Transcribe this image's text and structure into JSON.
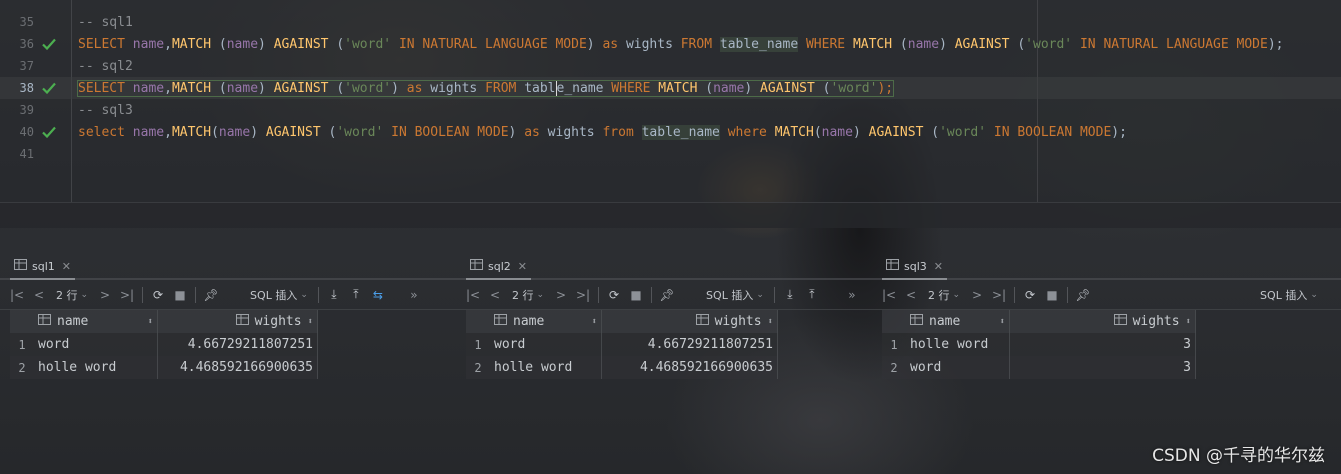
{
  "editor": {
    "lines": [
      {
        "num": "35",
        "checked": false,
        "current": false,
        "tokens": [
          {
            "t": "cm",
            "v": "-- sql1"
          }
        ]
      },
      {
        "num": "36",
        "checked": true,
        "current": false,
        "tokens": [
          {
            "t": "kw",
            "v": "SELECT "
          },
          {
            "t": "col",
            "v": "name"
          },
          {
            "t": "plain",
            "v": ","
          },
          {
            "t": "fn",
            "v": "MATCH "
          },
          {
            "t": "plain",
            "v": "("
          },
          {
            "t": "col",
            "v": "name"
          },
          {
            "t": "plain",
            "v": ") "
          },
          {
            "t": "fn",
            "v": "AGAINST "
          },
          {
            "t": "plain",
            "v": "("
          },
          {
            "t": "str",
            "v": "'word'"
          },
          {
            "t": "kw",
            "v": " IN NATURAL LANGUAGE MODE"
          },
          {
            "t": "plain",
            "v": ") "
          },
          {
            "t": "kw",
            "v": "as "
          },
          {
            "t": "plain",
            "v": "wights "
          },
          {
            "t": "kw",
            "v": "FROM "
          },
          {
            "t": "tbl",
            "v": "table_name"
          },
          {
            "t": "kw",
            "v": " WHERE "
          },
          {
            "t": "fn",
            "v": "MATCH "
          },
          {
            "t": "plain",
            "v": "("
          },
          {
            "t": "col",
            "v": "name"
          },
          {
            "t": "plain",
            "v": ") "
          },
          {
            "t": "fn",
            "v": "AGAINST "
          },
          {
            "t": "plain",
            "v": "("
          },
          {
            "t": "str",
            "v": "'word'"
          },
          {
            "t": "kw",
            "v": " IN NATURAL LANGUAGE MODE"
          },
          {
            "t": "plain",
            "v": ");"
          }
        ]
      },
      {
        "num": "37",
        "checked": false,
        "current": false,
        "tokens": [
          {
            "t": "cm",
            "v": "-- sql2"
          }
        ]
      },
      {
        "num": "38",
        "checked": true,
        "current": true,
        "tokens": [
          {
            "t": "kw",
            "v": "SELECT "
          },
          {
            "t": "col",
            "v": "name"
          },
          {
            "t": "plain",
            "v": ","
          },
          {
            "t": "fn",
            "v": "MATCH "
          },
          {
            "t": "plain",
            "v": "("
          },
          {
            "t": "col",
            "v": "name"
          },
          {
            "t": "plain",
            "v": ") "
          },
          {
            "t": "fn",
            "v": "AGAINST "
          },
          {
            "t": "plain",
            "v": "("
          },
          {
            "t": "str",
            "v": "'word'"
          },
          {
            "t": "plain",
            "v": ") "
          },
          {
            "t": "kw",
            "v": "as "
          },
          {
            "t": "plain",
            "v": "wights "
          },
          {
            "t": "kw",
            "v": "FROM "
          },
          {
            "t": "plain",
            "v": "tabl"
          },
          {
            "t": "caret",
            "v": ""
          },
          {
            "t": "plain",
            "v": "e_name"
          },
          {
            "t": "kw",
            "v": " WHERE "
          },
          {
            "t": "fn",
            "v": "MATCH "
          },
          {
            "t": "plain",
            "v": "("
          },
          {
            "t": "col",
            "v": "name"
          },
          {
            "t": "plain",
            "v": ") "
          },
          {
            "t": "fn",
            "v": "AGAINST "
          },
          {
            "t": "plain",
            "v": "("
          },
          {
            "t": "str",
            "v": "'word'"
          },
          {
            "t": "kw",
            "v": ");"
          }
        ]
      },
      {
        "num": "39",
        "checked": false,
        "current": false,
        "tokens": [
          {
            "t": "cm",
            "v": "-- sql3"
          }
        ]
      },
      {
        "num": "40",
        "checked": true,
        "current": false,
        "tokens": [
          {
            "t": "kw",
            "v": "select "
          },
          {
            "t": "col",
            "v": "name"
          },
          {
            "t": "plain",
            "v": ","
          },
          {
            "t": "fn",
            "v": "MATCH"
          },
          {
            "t": "plain",
            "v": "("
          },
          {
            "t": "col",
            "v": "name"
          },
          {
            "t": "plain",
            "v": ") "
          },
          {
            "t": "fn",
            "v": "AGAINST "
          },
          {
            "t": "plain",
            "v": "("
          },
          {
            "t": "str",
            "v": "'word'"
          },
          {
            "t": "kw",
            "v": " IN BOOLEAN MODE"
          },
          {
            "t": "plain",
            "v": ") "
          },
          {
            "t": "kw",
            "v": "as "
          },
          {
            "t": "plain",
            "v": "wights "
          },
          {
            "t": "kw",
            "v": "from "
          },
          {
            "t": "tbl",
            "v": "table_name"
          },
          {
            "t": "kw",
            "v": " where "
          },
          {
            "t": "fn",
            "v": "MATCH"
          },
          {
            "t": "plain",
            "v": "("
          },
          {
            "t": "col",
            "v": "name"
          },
          {
            "t": "plain",
            "v": ") "
          },
          {
            "t": "fn",
            "v": "AGAINST "
          },
          {
            "t": "plain",
            "v": "("
          },
          {
            "t": "str",
            "v": "'word'"
          },
          {
            "t": "kw",
            "v": " IN BOOLEAN MODE"
          },
          {
            "t": "plain",
            "v": ");"
          }
        ]
      },
      {
        "num": "41",
        "checked": false,
        "current": false,
        "tokens": []
      }
    ]
  },
  "panels": [
    {
      "tab_label": "sql1",
      "rows_label": "2 行",
      "mode_label": "SQL 插入",
      "columns": [
        "name",
        "wights"
      ],
      "rows": [
        {
          "num": "1",
          "cells": [
            "word",
            "4.66729211807251"
          ]
        },
        {
          "num": "2",
          "cells": [
            "holle word",
            "4.468592166900635"
          ]
        }
      ]
    },
    {
      "tab_label": "sql2",
      "rows_label": "2 行",
      "mode_label": "SQL 插入",
      "columns": [
        "name",
        "wights"
      ],
      "rows": [
        {
          "num": "1",
          "cells": [
            "word",
            "4.66729211807251"
          ]
        },
        {
          "num": "2",
          "cells": [
            "holle word",
            "4.468592166900635"
          ]
        }
      ]
    },
    {
      "tab_label": "sql3",
      "rows_label": "2 行",
      "mode_label": "SQL 插入",
      "columns": [
        "name",
        "wights"
      ],
      "rows": [
        {
          "num": "1",
          "cells": [
            "holle word",
            "3"
          ]
        },
        {
          "num": "2",
          "cells": [
            "word",
            "3"
          ]
        }
      ]
    }
  ],
  "watermark": "CSDN @千寻的华尔兹",
  "colors": {
    "keyword": "#cc7832",
    "function": "#ffc66d",
    "string": "#6a8759",
    "column": "#9876aa",
    "comment": "#8a8d91",
    "check": "#4caf50"
  }
}
